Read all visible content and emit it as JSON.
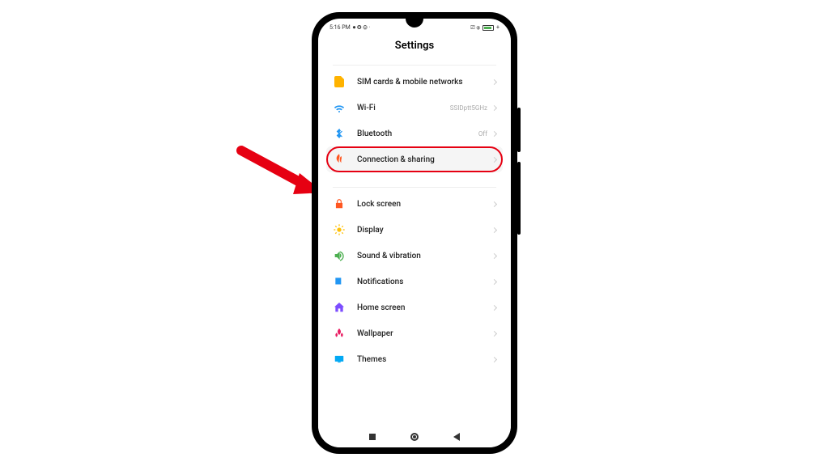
{
  "statusbar": {
    "time": "5:16 PM",
    "icons_left": "⏺ ✪ ⚙ ·",
    "icons_right": "⎚ ⦿"
  },
  "header": {
    "title": "Settings"
  },
  "sections": [
    {
      "rows": [
        {
          "icon": "sim-icon",
          "label": "SIM cards & mobile networks",
          "value": ""
        },
        {
          "icon": "wifi-icon",
          "label": "Wi-Fi",
          "value": "SSIDptt5GHz"
        },
        {
          "icon": "bluetooth-icon",
          "label": "Bluetooth",
          "value": "Off"
        },
        {
          "icon": "connection-icon",
          "label": "Connection & sharing",
          "value": "",
          "highlight": true
        }
      ]
    },
    {
      "rows": [
        {
          "icon": "lock-icon",
          "label": "Lock screen",
          "value": ""
        },
        {
          "icon": "display-icon",
          "label": "Display",
          "value": ""
        },
        {
          "icon": "sound-icon",
          "label": "Sound & vibration",
          "value": ""
        },
        {
          "icon": "notifications-icon",
          "label": "Notifications",
          "value": ""
        },
        {
          "icon": "home-icon",
          "label": "Home screen",
          "value": ""
        },
        {
          "icon": "wallpaper-icon",
          "label": "Wallpaper",
          "value": ""
        },
        {
          "icon": "themes-icon",
          "label": "Themes",
          "value": ""
        }
      ]
    }
  ],
  "annotation": {
    "arrow_target": "Connection & sharing"
  }
}
